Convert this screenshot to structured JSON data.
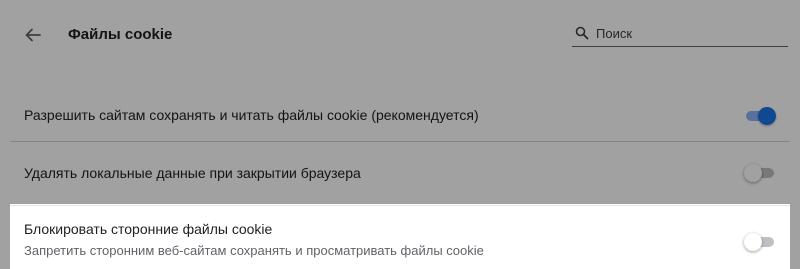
{
  "header": {
    "title": "Файлы cookie",
    "back_icon": "arrow-left-icon",
    "search": {
      "icon": "search-icon",
      "placeholder": "Поиск",
      "value": ""
    }
  },
  "settings": {
    "items": [
      {
        "label": "Разрешить сайтам сохранять и читать файлы cookie (рекомендуется)",
        "enabled": true
      },
      {
        "label": "Удалять локальные данные при закрытии браузера",
        "enabled": false
      },
      {
        "label": "Блокировать сторонние файлы cookie",
        "sublabel": "Запретить сторонним веб-сайтам сохранять и просматривать файлы cookie",
        "enabled": false,
        "highlighted": true
      }
    ]
  },
  "colors": {
    "accent": "#1a73e8",
    "accent_track": "#8ab4f8",
    "text_primary": "#202124",
    "text_secondary": "#5f6368",
    "overlay": "rgba(0,0,0,0.37)"
  }
}
